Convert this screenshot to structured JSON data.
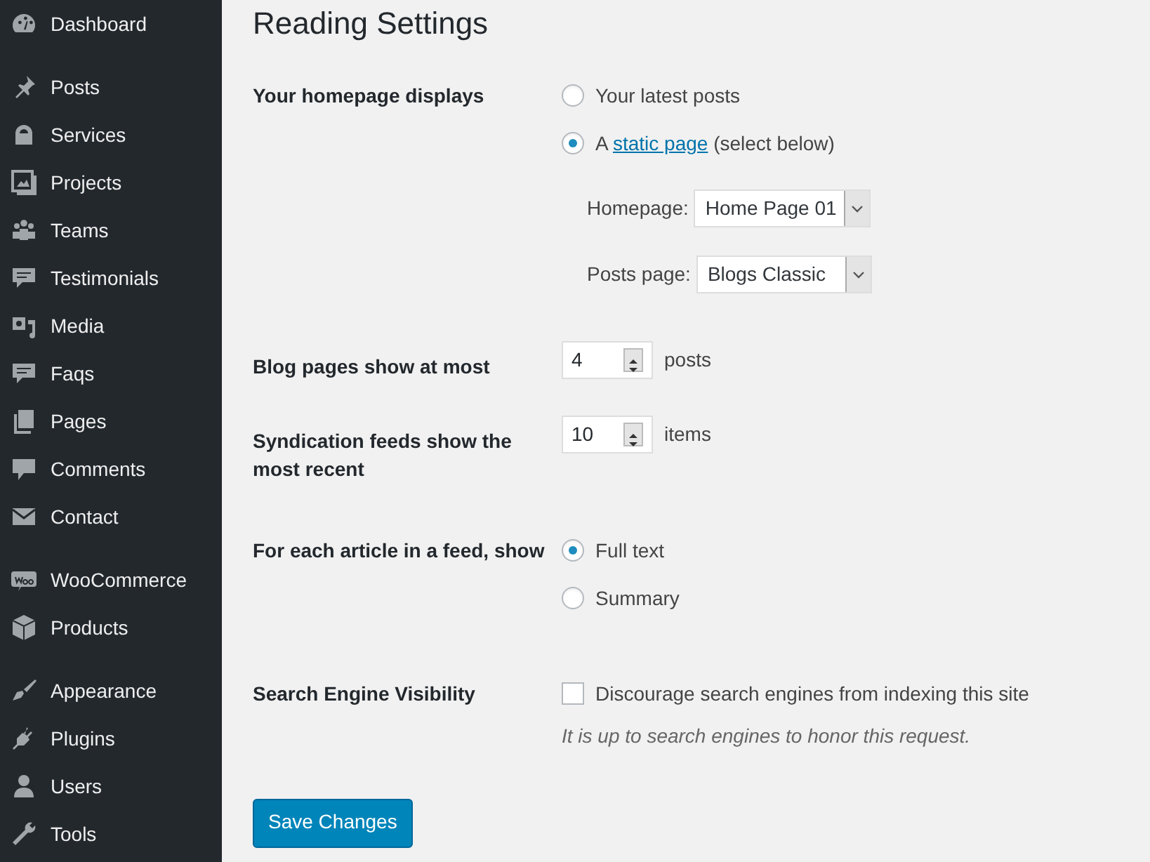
{
  "sidebar": {
    "menu_groups": [
      [
        {
          "label": "Dashboard"
        }
      ],
      [
        {
          "label": "Posts"
        },
        {
          "label": "Services"
        },
        {
          "label": "Projects"
        },
        {
          "label": "Teams"
        },
        {
          "label": "Testimonials"
        },
        {
          "label": "Media"
        },
        {
          "label": "Faqs"
        },
        {
          "label": "Pages"
        },
        {
          "label": "Comments"
        },
        {
          "label": "Contact"
        }
      ],
      [
        {
          "label": "WooCommerce"
        },
        {
          "label": "Products"
        }
      ],
      [
        {
          "label": "Appearance"
        },
        {
          "label": "Plugins"
        },
        {
          "label": "Users"
        },
        {
          "label": "Tools"
        }
      ]
    ]
  },
  "page_title": "Reading Settings",
  "rows": [
    {
      "kind": "radio",
      "label": "Your homepage displays",
      "options": [
        {
          "label": "Your latest posts",
          "selected": false
        },
        {
          "text_before": "A ",
          "link": "static page",
          "text_after": " (select below)",
          "selected": true,
          "selects": [
            {
              "label": "Homepage:",
              "value": "Home Page 01"
            },
            {
              "label": "Posts page:",
              "value": "Blogs Classic"
            }
          ]
        }
      ]
    },
    {
      "kind": "number",
      "label": "Blog pages show at most",
      "value": "4",
      "unit": "posts"
    },
    {
      "kind": "number",
      "label": "Syndication feeds show the most recent",
      "value": "10",
      "unit": "items"
    },
    {
      "kind": "radio",
      "label": "For each article in a feed, show",
      "options": [
        {
          "label": "Full text",
          "selected": true
        },
        {
          "label": "Summary",
          "selected": false
        }
      ]
    },
    {
      "kind": "checkbox",
      "label": "Search Engine Visibility",
      "option": "Discourage search engines from indexing this site",
      "checked": false,
      "description": "It is up to search engines to honor this request."
    }
  ],
  "save_button": "Save Changes"
}
